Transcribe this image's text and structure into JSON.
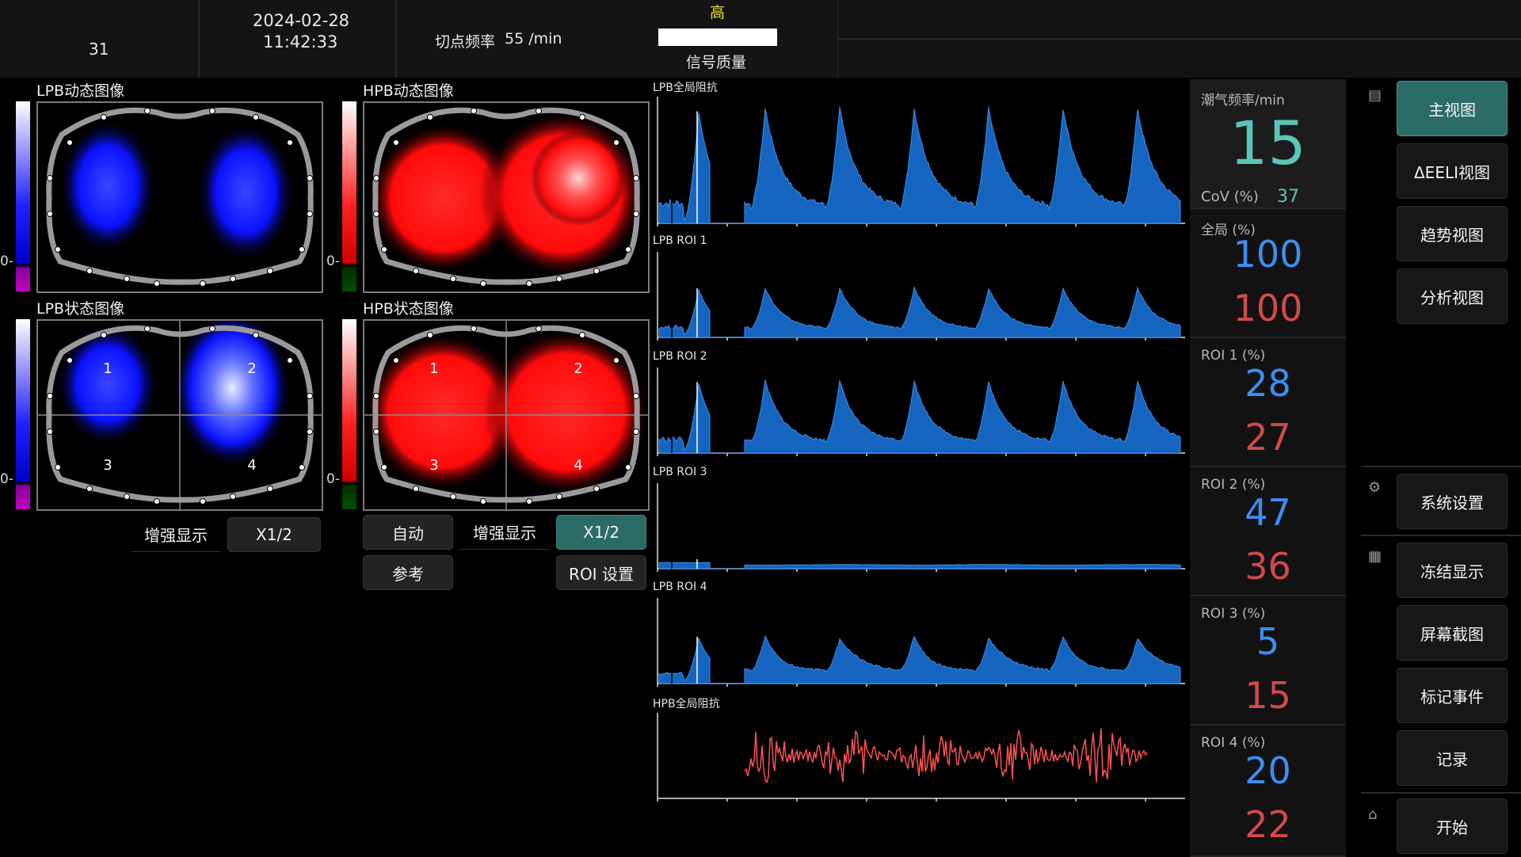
{
  "header": {
    "left_value": "31",
    "date": "2024-02-28",
    "time": "11:42:33",
    "rate_label": "切点频率",
    "rate_value": "55 /min",
    "quality_level": "高",
    "quality_label": "信号质量",
    "quality_fraction": 1.0
  },
  "images": {
    "lpb_dynamic": "LPB动态图像",
    "hpb_dynamic": "HPB动态图像",
    "lpb_status": "LPB状态图像",
    "hpb_status": "HPB状态图像",
    "zero": "0-",
    "quadrants": [
      "1",
      "2",
      "3",
      "4"
    ]
  },
  "buttons": {
    "lpb_enhance": "增强显示",
    "lpb_scale": "X1/2",
    "auto": "自动",
    "hpb_enhance": "增强显示",
    "hpb_scale": "X1/2",
    "reference": "参考",
    "roi_settings": "ROI 设置"
  },
  "waveforms": [
    {
      "label": "LPB全局阻抗"
    },
    {
      "label": "LPB ROI 1"
    },
    {
      "label": "LPB ROI 2"
    },
    {
      "label": "LPB ROI 3"
    },
    {
      "label": "LPB ROI 4"
    },
    {
      "label": "HPB全局阻抗"
    }
  ],
  "metrics": {
    "tidal_rate_label": "潮气频率/min",
    "tidal_rate_value": "15",
    "cov_label": "CoV (%)",
    "cov_value": "37",
    "rows": [
      {
        "label": "全局 (%)",
        "blue": "100",
        "red": "100"
      },
      {
        "label": "ROI 1 (%)",
        "blue": "28",
        "red": "27"
      },
      {
        "label": "ROI 2 (%)",
        "blue": "47",
        "red": "36"
      },
      {
        "label": "ROI 3 (%)",
        "blue": "5",
        "red": "15"
      },
      {
        "label": "ROI 4 (%)",
        "blue": "20",
        "red": "22"
      }
    ]
  },
  "nav": {
    "main_view": "主视图",
    "eeli_view": "ΔEELI视图",
    "trend_view": "趋势视图",
    "analysis_view": "分析视图",
    "system_settings": "系统设置",
    "freeze": "冻结显示",
    "screenshot": "屏幕截图",
    "mark_event": "标记事件",
    "record": "记录",
    "start": "开始"
  },
  "colors": {
    "accent_teal": "#2b6c67",
    "blue_value": "#3d8ef0",
    "red_value": "#d14a4a",
    "wave_blue": "#1565c0",
    "wave_red": "#ff5252",
    "quality_yellow": "#f0e030"
  }
}
